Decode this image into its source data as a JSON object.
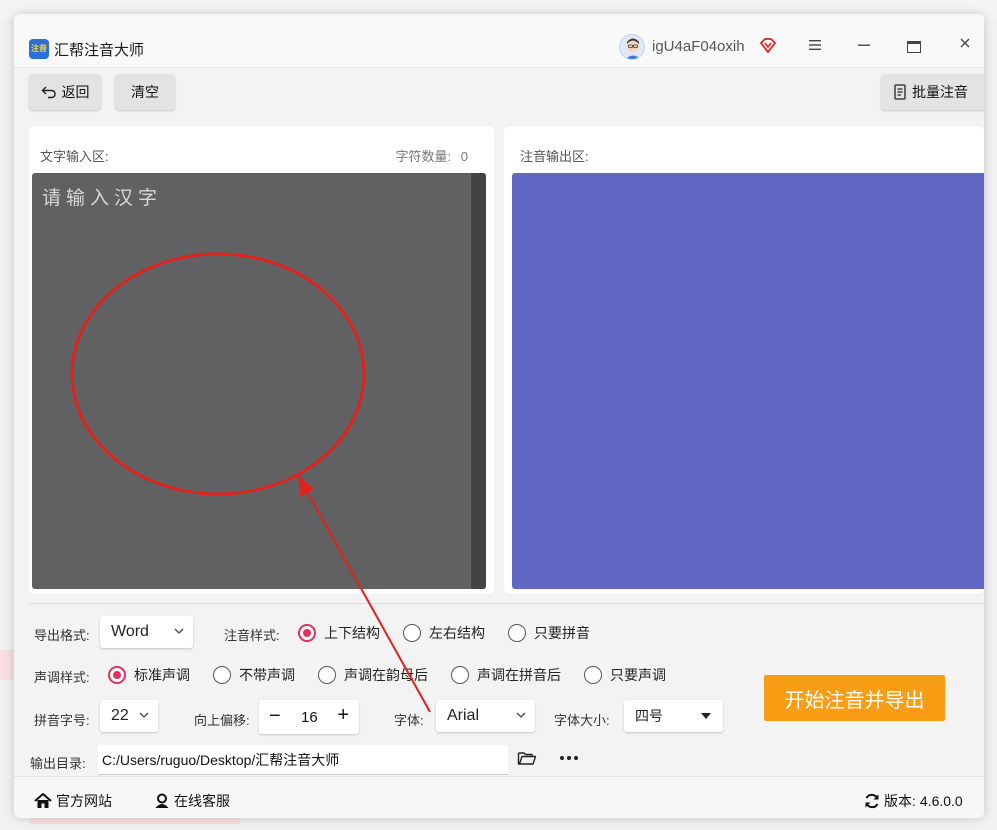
{
  "app": {
    "title": "汇帮注音大师",
    "icon_text": "注音",
    "username": "igU4aF04oxih"
  },
  "toolbar": {
    "back_label": "返回",
    "clear_label": "清空",
    "batch_label": "批量注音"
  },
  "input_panel": {
    "label": "文字输入区:",
    "count_label": "字符数量:",
    "count_value": "0",
    "placeholder": "请输入汉字"
  },
  "output_panel": {
    "label": "注音输出区:"
  },
  "settings": {
    "export_format": {
      "label": "导出格式:",
      "value": "Word"
    },
    "annotation_style": {
      "label": "注音样式:",
      "options": [
        "上下结构",
        "左右结构",
        "只要拼音"
      ],
      "selected": 0
    },
    "tone_style": {
      "label": "声调样式:",
      "options": [
        "标准声调",
        "不带声调",
        "声调在韵母后",
        "声调在拼音后",
        "只要声调"
      ],
      "selected": 0
    },
    "pinyin_size": {
      "label": "拼音字号:",
      "value": "22"
    },
    "offset": {
      "label": "向上偏移:",
      "value": "16",
      "minus": "−",
      "plus": "+"
    },
    "font": {
      "label": "字体:",
      "value": "Arial"
    },
    "font_size": {
      "label": "字体大小:",
      "value": "四号"
    },
    "output_dir": {
      "label": "输出目录:",
      "value": "C:/Users/ruguo/Desktop/汇帮注音大师"
    }
  },
  "start_button": "开始注音并导出",
  "footer": {
    "website": "官方网站",
    "support": "在线客服",
    "version_label": "版本:",
    "version_value": "4.6.0.0"
  },
  "colors": {
    "input_bg": "#616163",
    "output_bg": "#6068c4",
    "accent": "#e0325c",
    "start_btn": "#f99d14",
    "annotation": "#e0221c"
  },
  "icons": [
    "app-logo-icon",
    "avatar-icon",
    "vip-diamond-icon",
    "menu-icon",
    "minimize-icon",
    "maximize-icon",
    "close-icon",
    "back-arrow-icon",
    "document-icon",
    "chevron-down-icon",
    "folder-icon",
    "more-icon",
    "home-icon",
    "user-support-icon",
    "refresh-icon"
  ]
}
